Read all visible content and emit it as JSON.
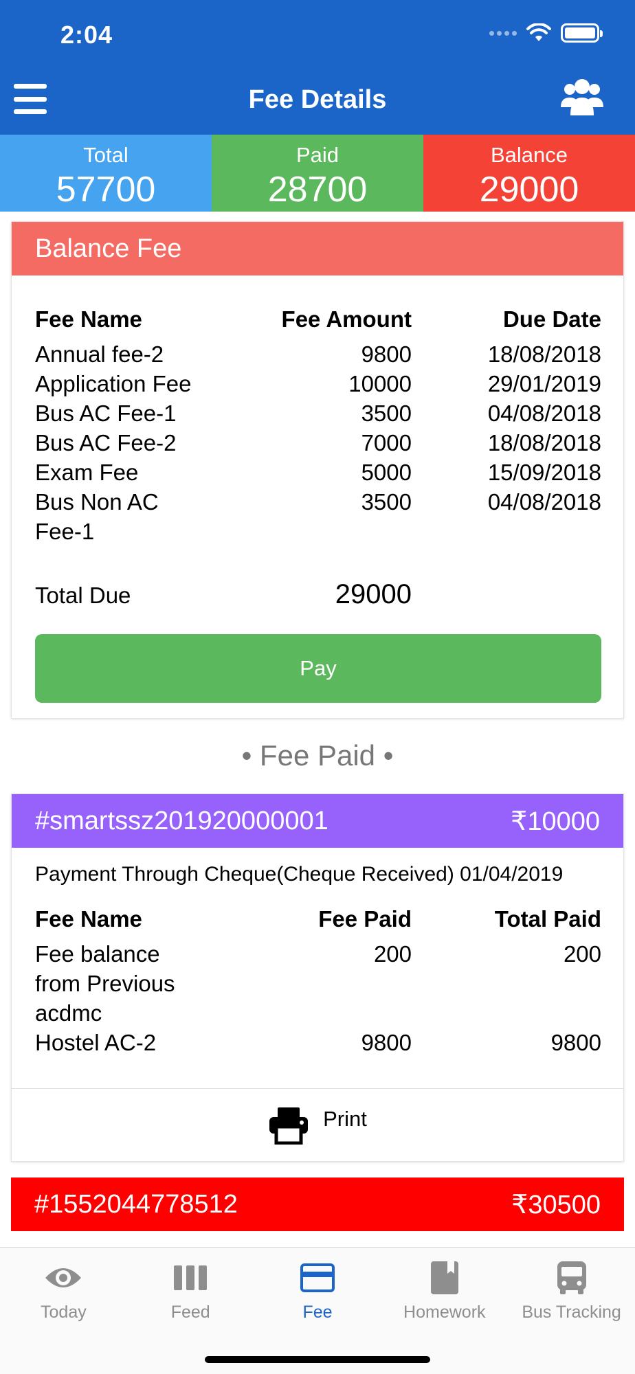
{
  "status_bar": {
    "time": "2:04"
  },
  "header": {
    "title": "Fee Details",
    "menu_icon": "hamburger-menu-icon",
    "group_icon": "users-group-icon"
  },
  "summary": [
    {
      "label": "Total",
      "value": "57700",
      "color": "#45a3ef"
    },
    {
      "label": "Paid",
      "value": "28700",
      "color": "#5cb85c"
    },
    {
      "label": "Balance",
      "value": "29000",
      "color": "#f44336"
    }
  ],
  "balance_fee": {
    "title": "Balance Fee",
    "columns": [
      "Fee Name",
      "Fee Amount",
      "Due Date"
    ],
    "rows": [
      {
        "name": "Annual fee-2",
        "amount": "9800",
        "due": "18/08/2018"
      },
      {
        "name": "Application Fee",
        "amount": "10000",
        "due": "29/01/2019"
      },
      {
        "name": "Bus AC Fee-1",
        "amount": "3500",
        "due": "04/08/2018"
      },
      {
        "name": "Bus AC Fee-2",
        "amount": "7000",
        "due": "18/08/2018"
      },
      {
        "name": "Exam Fee",
        "amount": "5000",
        "due": "15/09/2018"
      },
      {
        "name": "Bus Non AC Fee-1",
        "amount": "3500",
        "due": "04/08/2018"
      }
    ],
    "total_label": "Total Due",
    "total_value": "29000",
    "pay_label": "Pay"
  },
  "fee_paid_title": "• Fee Paid •",
  "receipts": [
    {
      "id": "#smartssz201920000001",
      "amount": "₹10000",
      "color": "#9762fb",
      "payment_info": "Payment Through Cheque(Cheque Received) 01/04/2019",
      "columns": [
        "Fee Name",
        "Fee Paid",
        "Total Paid"
      ],
      "rows": [
        {
          "name": "Fee balance from Previous acdmc",
          "paid": "200",
          "total": "200"
        },
        {
          "name": "Hostel AC-2",
          "paid": "9800",
          "total": "9800"
        }
      ],
      "print_label": "Print"
    },
    {
      "id": "#1552044778512",
      "amount": "₹30500",
      "color": "#ff0000"
    }
  ],
  "tabs": [
    {
      "label": "Today",
      "icon": "eye-icon",
      "active": false
    },
    {
      "label": "Feed",
      "icon": "columns-icon",
      "active": false
    },
    {
      "label": "Fee",
      "icon": "credit-card-icon",
      "active": true
    },
    {
      "label": "Homework",
      "icon": "book-icon",
      "active": false
    },
    {
      "label": "Bus Tracking",
      "icon": "bus-icon",
      "active": false
    }
  ]
}
